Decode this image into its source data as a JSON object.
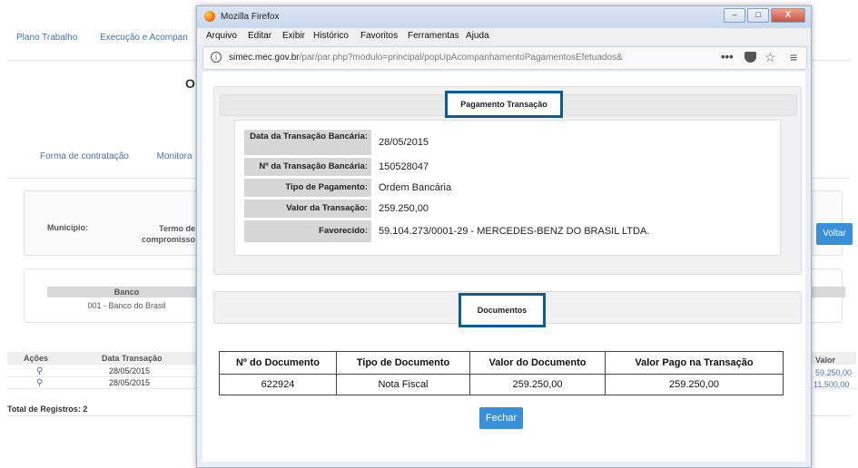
{
  "background": {
    "nav": [
      "Plano Trabalho",
      "Execução e Acompan"
    ],
    "heading_fragment": "O",
    "tabs": [
      "Forma de contratação",
      "Monitora"
    ],
    "filter": {
      "municipio_label": "Município:",
      "termo_label": "Termo de compromisso"
    },
    "voltar": "Voltar",
    "banco": {
      "header": "Banco",
      "value": "001 - Banco do Brasil"
    },
    "grid": {
      "headers": {
        "acoes": "Ações",
        "data": "Data Transação",
        "valor": "Valor"
      },
      "rows": [
        {
          "data": "28/05/2015",
          "valor": "59.250,00"
        },
        {
          "data": "28/05/2015",
          "valor": "11.500,00"
        }
      ],
      "total": "Total de Registros: 2"
    }
  },
  "window": {
    "title": "Mozilla Firefox",
    "menu": [
      "Arquivo",
      "Editar",
      "Exibir",
      "Histórico",
      "Favoritos",
      "Ferramentas",
      "Ajuda"
    ],
    "url_host": "simec.mec.gov.br",
    "url_path": "/par/par.php?modulo=principal/popUpAcompanhamentoPagamentosEfetuados&",
    "url_prefix": "",
    "buttons": {
      "minimize": "–",
      "maximize": "□",
      "close": "X"
    },
    "more_glyph": "•••",
    "star_glyph": "☆",
    "menu_glyph": "≡"
  },
  "popup": {
    "section1_title": "Pagamento Transação",
    "fields": [
      {
        "label": "Data da Transação Bancária:",
        "value": "28/05/2015"
      },
      {
        "label": "Nº da Transação Bancária:",
        "value": "150528047"
      },
      {
        "label": "Tipo de Pagamento:",
        "value": "Ordem Bancária"
      },
      {
        "label": "Valor da Transação:",
        "value": "259.250,00"
      },
      {
        "label": "Favorecido:",
        "value": "59.104.273/0001-29 - MERCEDES-BENZ DO BRASIL LTDA."
      }
    ],
    "section2_title": "Documentos",
    "table": {
      "headers": [
        "Nº do Documento",
        "Tipo de Documento",
        "Valor do Documento",
        "Valor Pago na Transação"
      ],
      "rows": [
        [
          "622924",
          "Nota Fiscal",
          "259.250,00",
          "259.250,00"
        ]
      ]
    },
    "close_button": "Fechar"
  },
  "colors": {
    "accent": "#3a8fd6",
    "highlight_border": "#0b5d8f",
    "link": "#4a6fa5"
  }
}
